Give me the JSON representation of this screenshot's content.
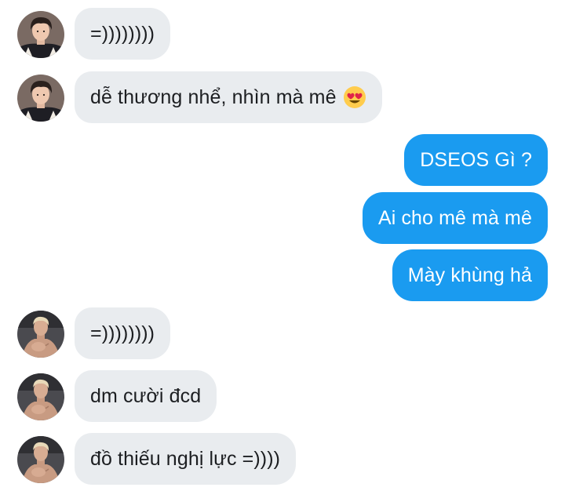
{
  "conversation": {
    "messages": [
      {
        "sender": "incoming",
        "avatar": "avatar-boy-in-varsity-jacket",
        "text": "=))))))))"
      },
      {
        "sender": "incoming",
        "avatar": "avatar-boy-in-varsity-jacket",
        "text": "dễ thương nhể, nhìn mà mê",
        "emoji": "heart-eyes-emoji"
      },
      {
        "sender": "outgoing",
        "text": "DSEOS Gì ?"
      },
      {
        "sender": "outgoing",
        "text": "Ai cho mê mà mê"
      },
      {
        "sender": "outgoing",
        "text": "Mày khùng hả"
      },
      {
        "sender": "incoming",
        "avatar": "avatar-shirtless-boy",
        "text": "=))))))))"
      },
      {
        "sender": "incoming",
        "avatar": "avatar-shirtless-boy",
        "text": "dm cười đcd"
      },
      {
        "sender": "incoming",
        "avatar": "avatar-shirtless-boy",
        "text": "đồ thiếu nghị lực =))))"
      }
    ]
  },
  "colors": {
    "incoming_bubble": "#e9ecef",
    "outgoing_bubble": "#1a9bf0",
    "incoming_text": "#1c1e21",
    "outgoing_text": "#ffffff"
  }
}
